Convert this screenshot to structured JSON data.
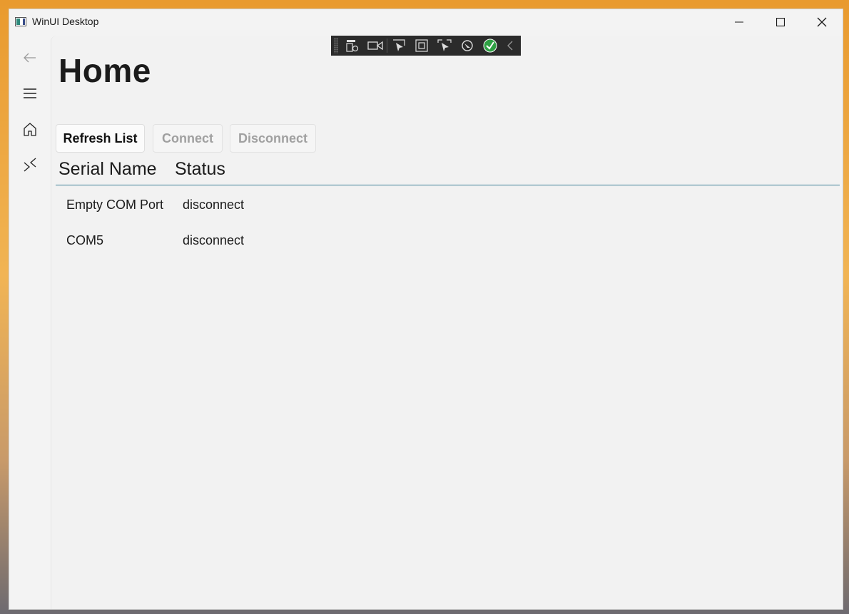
{
  "window": {
    "title": "WinUI Desktop"
  },
  "page": {
    "title": "Home"
  },
  "buttons": {
    "refresh": "Refresh List",
    "connect": "Connect",
    "disconnect": "Disconnect"
  },
  "table": {
    "headers": [
      "Serial Name",
      "Status"
    ],
    "rows": [
      {
        "name": "Empty COM Port",
        "status": "disconnect"
      },
      {
        "name": "COM5",
        "status": "disconnect"
      }
    ]
  },
  "nav": {
    "items": [
      "back-arrow-icon",
      "hamburger-menu-icon",
      "home-icon",
      "serial-connect-icon"
    ]
  },
  "colors": {
    "accent_line": "#3c7f97",
    "disabled_text": "#a0a0a0",
    "check_badge": "#2ea043"
  }
}
